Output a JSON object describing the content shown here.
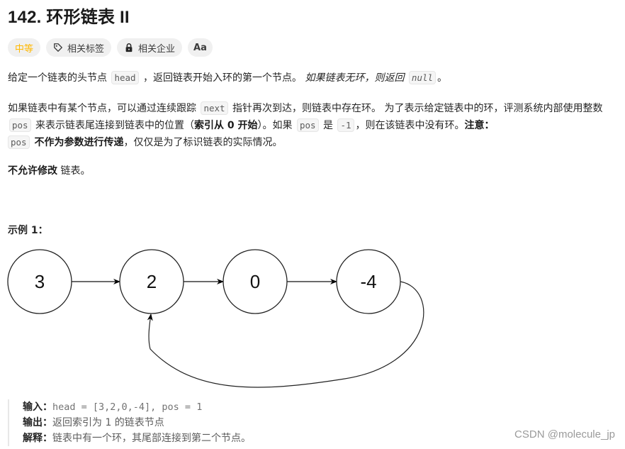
{
  "title": "142. 环形链表 II",
  "badges": {
    "difficulty": "中等",
    "tags": "相关标签",
    "companies": "相关企业",
    "lang": "Aa"
  },
  "colors": {
    "difficulty": "#ffb800",
    "badge_bg": "#f0f0f0"
  },
  "icons": {
    "tags": "tag-icon",
    "companies": "lock-icon",
    "lang": "translate-icon"
  },
  "p1": {
    "t1": "给定一个链表的头节点 ",
    "c1": "head",
    "t2": " ，返回链表开始入环的第一个节点。 ",
    "i1": "如果链表无环，则返回 ",
    "c2": "null",
    "t3": "。"
  },
  "p2": {
    "t1": "如果链表中有某个节点，可以通过连续跟踪 ",
    "c1": "next",
    "t2": " 指针再次到达，则链表中存在环。 为了表示给定链表中的环，评测系统内部使用整数 ",
    "c2": "pos",
    "t3": " 来表示链表尾连接到链表中的位置（",
    "b1": "索引从 0 开始",
    "t4": "）。如果 ",
    "c3": "pos",
    "t5": " 是 ",
    "c4": "-1",
    "t6": "，则在该链表中没有环。",
    "b2": "注意：",
    "c5": "pos",
    "b3": " 不作为参数进行传递",
    "t7": "，仅仅是为了标识链表的实际情况。"
  },
  "p3": {
    "b1": "不允许修改",
    "t1": " 链表。"
  },
  "example_title": "示例 1：",
  "diagram": {
    "nodes": [
      "3",
      "2",
      "0",
      "-4"
    ],
    "cycle_to_index": 1
  },
  "example": {
    "input_label": "输入：",
    "input_value": "head = [3,2,0,-4], pos = 1",
    "output_label": "输出：",
    "output_value": "返回索引为 1 的链表节点",
    "explain_label": "解释：",
    "explain_value": "链表中有一个环，其尾部连接到第二个节点。"
  },
  "watermark": "CSDN @molecule_jp"
}
